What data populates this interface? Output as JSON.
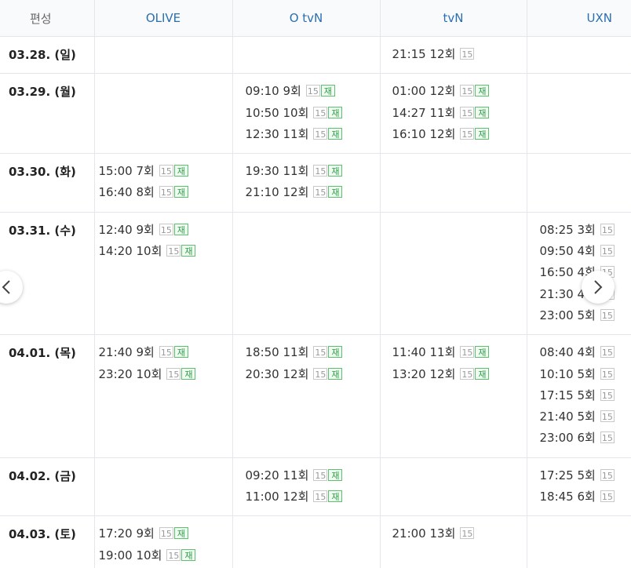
{
  "header": {
    "date_col": "편성",
    "channels": [
      "OLIVE",
      "O tvN",
      "tvN",
      "UXN"
    ]
  },
  "badges": {
    "age": "15",
    "rerun": "재"
  },
  "rows": [
    {
      "date": "03.28. (일)",
      "cells": [
        [],
        [],
        [
          {
            "time": "21:15",
            "ep": "12회",
            "re": false
          }
        ],
        []
      ]
    },
    {
      "date": "03.29. (월)",
      "cells": [
        [],
        [
          {
            "time": "09:10",
            "ep": "9회",
            "re": true
          },
          {
            "time": "10:50",
            "ep": "10회",
            "re": true
          },
          {
            "time": "12:30",
            "ep": "11회",
            "re": true
          }
        ],
        [
          {
            "time": "01:00",
            "ep": "12회",
            "re": true
          },
          {
            "time": "14:27",
            "ep": "11회",
            "re": true
          },
          {
            "time": "16:10",
            "ep": "12회",
            "re": true
          }
        ],
        []
      ]
    },
    {
      "date": "03.30. (화)",
      "cells": [
        [
          {
            "time": "15:00",
            "ep": "7회",
            "re": true
          },
          {
            "time": "16:40",
            "ep": "8회",
            "re": true
          }
        ],
        [
          {
            "time": "19:30",
            "ep": "11회",
            "re": true
          },
          {
            "time": "21:10",
            "ep": "12회",
            "re": true
          }
        ],
        [],
        []
      ]
    },
    {
      "date": "03.31. (수)",
      "cells": [
        [
          {
            "time": "12:40",
            "ep": "9회",
            "re": true
          },
          {
            "time": "14:20",
            "ep": "10회",
            "re": true
          }
        ],
        [],
        [],
        [
          {
            "time": "08:25",
            "ep": "3회",
            "re": false
          },
          {
            "time": "09:50",
            "ep": "4회",
            "re": false
          },
          {
            "time": "16:50",
            "ep": "4회",
            "re": false
          },
          {
            "time": "21:30",
            "ep": "4회",
            "re": false
          },
          {
            "time": "23:00",
            "ep": "5회",
            "re": false
          }
        ]
      ]
    },
    {
      "date": "04.01. (목)",
      "cells": [
        [
          {
            "time": "21:40",
            "ep": "9회",
            "re": true
          },
          {
            "time": "23:20",
            "ep": "10회",
            "re": true
          }
        ],
        [
          {
            "time": "18:50",
            "ep": "11회",
            "re": true
          },
          {
            "time": "20:30",
            "ep": "12회",
            "re": true
          }
        ],
        [
          {
            "time": "11:40",
            "ep": "11회",
            "re": true
          },
          {
            "time": "13:20",
            "ep": "12회",
            "re": true
          }
        ],
        [
          {
            "time": "08:40",
            "ep": "4회",
            "re": false
          },
          {
            "time": "10:10",
            "ep": "5회",
            "re": false
          },
          {
            "time": "17:15",
            "ep": "5회",
            "re": false
          },
          {
            "time": "21:40",
            "ep": "5회",
            "re": false
          },
          {
            "time": "23:00",
            "ep": "6회",
            "re": false
          }
        ]
      ]
    },
    {
      "date": "04.02. (금)",
      "cells": [
        [],
        [
          {
            "time": "09:20",
            "ep": "11회",
            "re": true
          },
          {
            "time": "11:00",
            "ep": "12회",
            "re": true
          }
        ],
        [],
        [
          {
            "time": "17:25",
            "ep": "5회",
            "re": false
          },
          {
            "time": "18:45",
            "ep": "6회",
            "re": false
          }
        ]
      ]
    },
    {
      "date": "04.03. (토)",
      "cells": [
        [
          {
            "time": "17:20",
            "ep": "9회",
            "re": true
          },
          {
            "time": "19:00",
            "ep": "10회",
            "re": true
          }
        ],
        [],
        [
          {
            "time": "21:00",
            "ep": "13회",
            "re": false
          }
        ],
        []
      ]
    }
  ],
  "nav": {
    "prev_icon": "chevron-left-icon",
    "next_icon": "chevron-right-icon"
  }
}
